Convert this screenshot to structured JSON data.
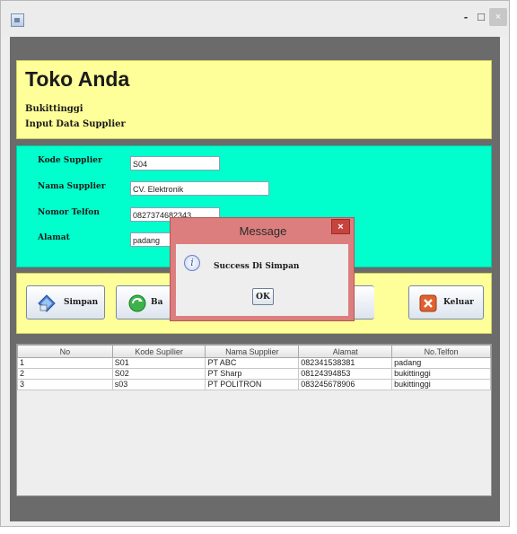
{
  "window": {
    "minimize": "-",
    "maximize": "□",
    "close": "×"
  },
  "header": {
    "title": "Toko Anda",
    "city": "Bukittinggi",
    "subtitle": "Input Data Supplier"
  },
  "form": {
    "kode_label": "Kode Supplier",
    "kode_value": "S04",
    "nama_label": "Nama Supplier",
    "nama_value": "CV. Elektronik",
    "telfon_label": "Nomor Telfon",
    "telfon_value": "0827374682343",
    "alamat_label": "Alamat",
    "alamat_value": "padang"
  },
  "buttons": {
    "simpan": "Simpan",
    "batal_partial": "Ba",
    "keluar": "Keluar"
  },
  "table": {
    "columns": [
      "No",
      "Kode Supllier",
      "Nama Supplier",
      "Alamat",
      "No.Telfon"
    ],
    "rows": [
      [
        "1",
        "S01",
        "PT ABC",
        "082341538381",
        "padang"
      ],
      [
        "2",
        "S02",
        "PT Sharp",
        "08124394853",
        "bukittinggi"
      ],
      [
        "3",
        "s03",
        "PT POLITRON",
        "083245678906",
        "bukittinggi"
      ]
    ]
  },
  "dialog": {
    "title": "Message",
    "close": "×",
    "message": "Success Di Simpan",
    "ok": "OK",
    "icon": "info-icon"
  },
  "colors": {
    "header_bg": "#ffff99",
    "form_bg": "#00ffcc",
    "dialog_frame": "#dc7e7e",
    "close_red": "#c8433d"
  }
}
